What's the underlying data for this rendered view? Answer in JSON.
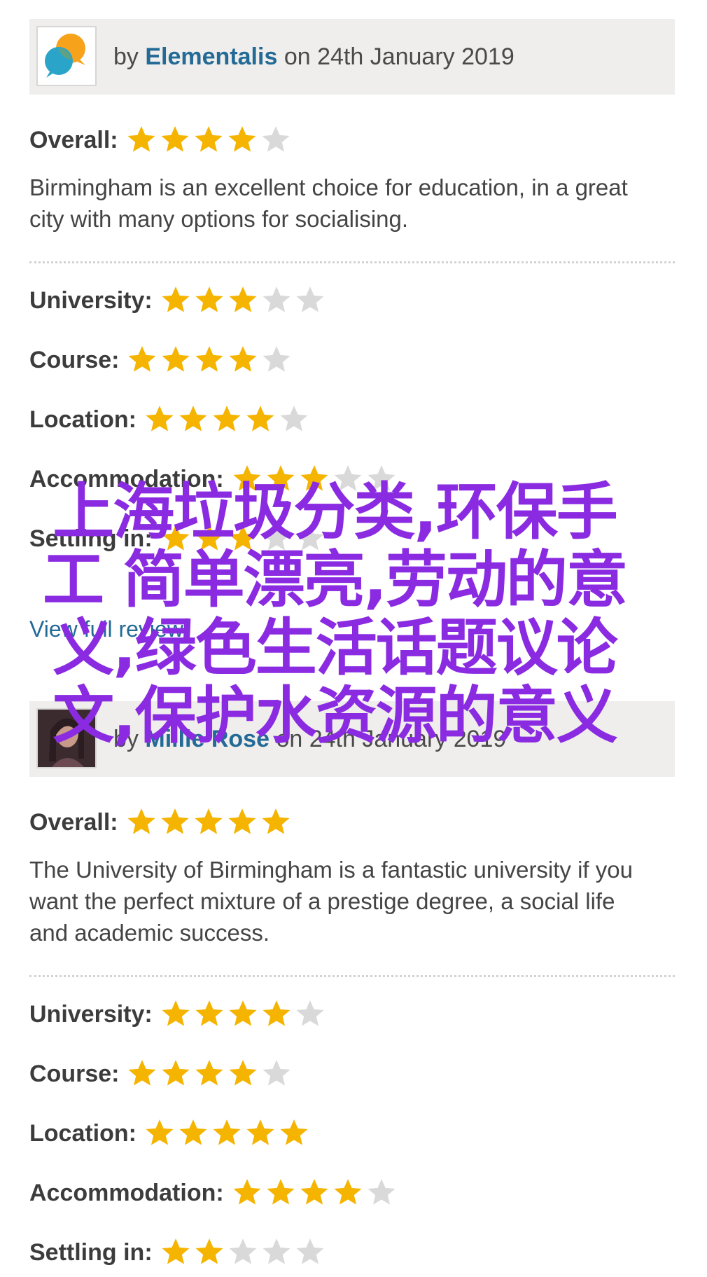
{
  "reviews": [
    {
      "by": "by",
      "author": "Elementalis",
      "date": "on 24th January 2019",
      "overall_label": "Overall:",
      "overall_stars": 4,
      "text": "Birmingham is an excellent choice for education, in a great city with many options for socialising.",
      "ratings": [
        {
          "label": "University:",
          "stars": 3
        },
        {
          "label": "Course:",
          "stars": 4
        },
        {
          "label": "Location:",
          "stars": 4
        },
        {
          "label": "Accommodation:",
          "stars": 3
        },
        {
          "label": "Settling in:",
          "stars": 3
        }
      ],
      "view_full": "View full review"
    },
    {
      "by": "by",
      "author": "Millie Rose",
      "date": "on 24th January 2019",
      "overall_label": "Overall:",
      "overall_stars": 5,
      "text": "The University of Birmingham is a fantastic university if you want the perfect mixture of a prestige degree, a social life and academic success.",
      "ratings": [
        {
          "label": "University:",
          "stars": 4
        },
        {
          "label": "Course:",
          "stars": 4
        },
        {
          "label": "Location:",
          "stars": 5
        },
        {
          "label": "Accommodation:",
          "stars": 4
        },
        {
          "label": "Settling in:",
          "stars": 2
        }
      ]
    }
  ],
  "max_stars": 5,
  "colors": {
    "star_filled": "#f5b400",
    "star_empty": "#d9d9d9",
    "author": "#236a96",
    "overlay": "#8a2be2"
  },
  "overlay_text": "上海垃圾分类,环保手工 简单漂亮,劳动的意义,绿色生活话题议论文,保护水资源的意义"
}
